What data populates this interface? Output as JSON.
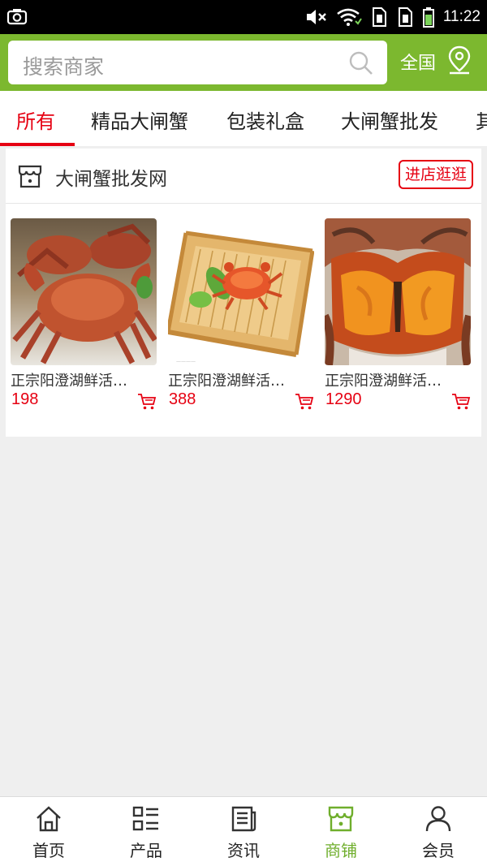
{
  "status_bar": {
    "time": "11:22"
  },
  "header": {
    "search_placeholder": "搜索商家",
    "region": "全国"
  },
  "tabs": [
    {
      "label": "所有",
      "active": true
    },
    {
      "label": "精品大闸蟹"
    },
    {
      "label": "包装礼盒"
    },
    {
      "label": "大闸蟹批发"
    },
    {
      "label": "其"
    }
  ],
  "shop": {
    "name": "大闸蟹批发网",
    "enter_label": "进店逛逛",
    "products": [
      {
        "name": "正宗阳澄湖鲜活…",
        "price": "198"
      },
      {
        "name": "正宗阳澄湖鲜活…",
        "price": "388"
      },
      {
        "name": "正宗阳澄湖鲜活…",
        "price": "1290"
      }
    ]
  },
  "bottom_nav": [
    {
      "label": "首页",
      "icon": "home-icon"
    },
    {
      "label": "产品",
      "icon": "list-icon"
    },
    {
      "label": "资讯",
      "icon": "news-icon"
    },
    {
      "label": "商铺",
      "icon": "shop-icon",
      "active": true
    },
    {
      "label": "会员",
      "icon": "user-icon"
    }
  ],
  "colors": {
    "brand_green": "#7cb82f",
    "accent_red": "#e60012",
    "active_nav": "#6fae2c"
  }
}
